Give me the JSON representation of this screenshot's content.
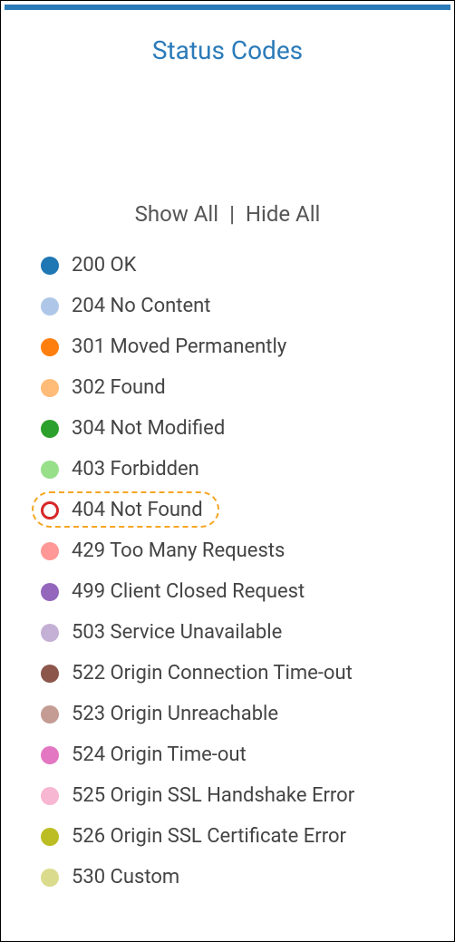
{
  "title": "Status Codes",
  "controls": {
    "show_all": "Show All",
    "hide_all": "Hide All",
    "separator": "|"
  },
  "items": [
    {
      "label": "200 OK",
      "color": "#1f77b4",
      "hollow": false,
      "highlighted": false
    },
    {
      "label": "204 No Content",
      "color": "#aec7e8",
      "hollow": false,
      "highlighted": false
    },
    {
      "label": "301 Moved Permanently",
      "color": "#ff7f0e",
      "hollow": false,
      "highlighted": false
    },
    {
      "label": "302 Found",
      "color": "#ffbb78",
      "hollow": false,
      "highlighted": false
    },
    {
      "label": "304 Not Modified",
      "color": "#2ca02c",
      "hollow": false,
      "highlighted": false
    },
    {
      "label": "403 Forbidden",
      "color": "#98df8a",
      "hollow": false,
      "highlighted": false
    },
    {
      "label": "404 Not Found",
      "color": "#d62728",
      "hollow": true,
      "highlighted": true
    },
    {
      "label": "429 Too Many Requests",
      "color": "#ff9896",
      "hollow": false,
      "highlighted": false
    },
    {
      "label": "499 Client Closed Request",
      "color": "#9467bd",
      "hollow": false,
      "highlighted": false
    },
    {
      "label": "503 Service Unavailable",
      "color": "#c5b0d5",
      "hollow": false,
      "highlighted": false
    },
    {
      "label": "522 Origin Connection Time-out",
      "color": "#8c564b",
      "hollow": false,
      "highlighted": false
    },
    {
      "label": "523 Origin Unreachable",
      "color": "#c49c94",
      "hollow": false,
      "highlighted": false
    },
    {
      "label": "524 Origin Time-out",
      "color": "#e377c2",
      "hollow": false,
      "highlighted": false
    },
    {
      "label": "525 Origin SSL Handshake Error",
      "color": "#f7b6d2",
      "hollow": false,
      "highlighted": false
    },
    {
      "label": "526 Origin SSL Certificate Error",
      "color": "#bcbd22",
      "hollow": false,
      "highlighted": false
    },
    {
      "label": "530 Custom",
      "color": "#dbdb8d",
      "hollow": false,
      "highlighted": false
    }
  ]
}
